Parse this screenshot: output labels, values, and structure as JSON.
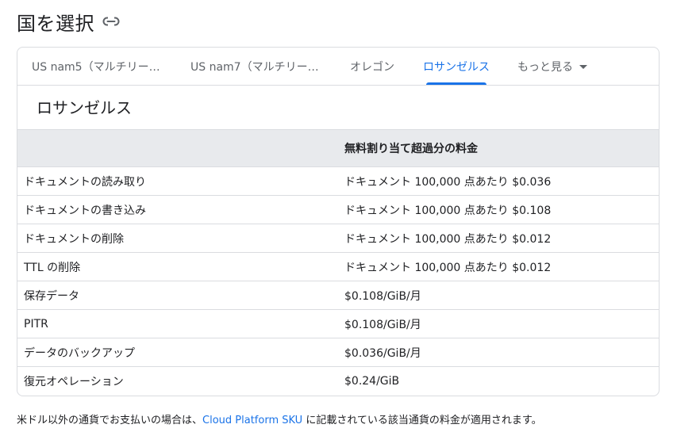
{
  "heading": {
    "title": "国を選択"
  },
  "tabs": [
    {
      "label": "US nam5（マルチリー…"
    },
    {
      "label": "US nam7（マルチリー…"
    },
    {
      "label": "オレゴン"
    },
    {
      "label": "ロサンゼルス"
    },
    {
      "label": "もっと見る"
    }
  ],
  "active_tab": "ロサンゼルス",
  "region": {
    "title": "ロサンゼルス"
  },
  "table": {
    "header": {
      "col1": "",
      "col2": "無料割り当て超過分の料金"
    },
    "rows": [
      {
        "name": "ドキュメントの読み取り",
        "price": "ドキュメント 100,000 点あたり $0.036"
      },
      {
        "name": "ドキュメントの書き込み",
        "price": "ドキュメント 100,000 点あたり $0.108"
      },
      {
        "name": "ドキュメントの削除",
        "price": "ドキュメント 100,000 点あたり $0.012"
      },
      {
        "name": "TTL の削除",
        "price": "ドキュメント 100,000 点あたり $0.012"
      },
      {
        "name": "保存データ",
        "price": "$0.108/GiB/月"
      },
      {
        "name": "PITR",
        "price": "$0.108/GiB/月"
      },
      {
        "name": "データのバックアップ",
        "price": "$0.036/GiB/月"
      },
      {
        "name": "復元オペレーション",
        "price": "$0.24/GiB"
      }
    ]
  },
  "footnote": {
    "prefix": "米ドル以外の通貨でお支払いの場合は、",
    "link": "Cloud Platform SKU",
    "suffix": " に記載されている該当通貨の料金が適用されます。"
  },
  "colors": {
    "accent": "#1a73e8",
    "border": "#dadce0",
    "header_bg": "#e8eaed",
    "text": "#202124",
    "muted": "#5f6368"
  },
  "icons": {
    "heading_link": "link-icon",
    "more_tabs": "caret-down-icon"
  }
}
